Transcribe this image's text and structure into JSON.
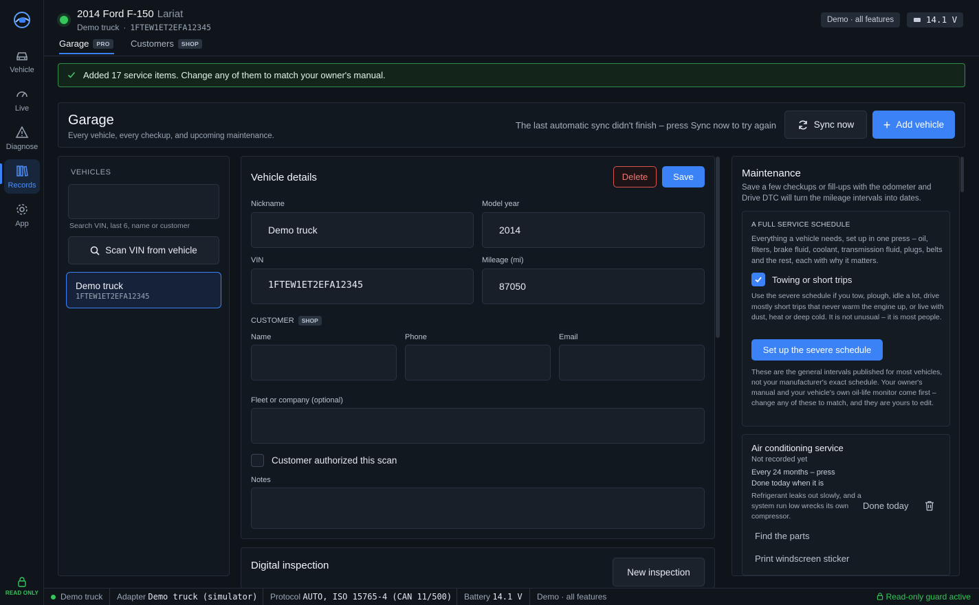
{
  "rail": {
    "items": [
      {
        "label": "Vehicle",
        "icon": "car-icon"
      },
      {
        "label": "Live",
        "icon": "gauge-icon"
      },
      {
        "label": "Diagnose",
        "icon": "warning-icon"
      },
      {
        "label": "Records",
        "icon": "books-icon",
        "active": true
      },
      {
        "label": "App",
        "icon": "gear-icon"
      }
    ],
    "read_only_label": "READ ONLY"
  },
  "header": {
    "vehicle_title": "2014 Ford F-150",
    "vehicle_trim": "Lariat",
    "nickname": "Demo truck",
    "separator": "·",
    "vin": "1FTEW1ET2EFA12345",
    "demo_label": "Demo · all features",
    "voltage": "14.1 V",
    "tabs": [
      {
        "label": "Garage",
        "badge": "PRO",
        "active": true
      },
      {
        "label": "Customers",
        "badge": "SHOP",
        "active": false
      }
    ]
  },
  "toast": {
    "text": "Added 17 service items. Change any of them to match your owner's manual."
  },
  "garage": {
    "title": "Garage",
    "description": "Every vehicle, every checkup, and upcoming maintenance.",
    "sync_message": "The last automatic sync didn't finish – press Sync now to try again",
    "sync_button": "Sync now",
    "add_button": "Add vehicle"
  },
  "vehicles": {
    "heading": "VEHICLES",
    "search_value": "",
    "search_hint": "Search VIN, last 6, name or customer",
    "scan_button": "Scan VIN from vehicle",
    "list": [
      {
        "name": "Demo truck",
        "vin": "1FTEW1ET2EFA12345"
      }
    ]
  },
  "details": {
    "title": "Vehicle details",
    "delete_button": "Delete",
    "save_button": "Save",
    "nickname_label": "Nickname",
    "nickname_value": "Demo truck",
    "model_year_label": "Model year",
    "model_year_value": "2014",
    "vin_label": "VIN",
    "vin_value": "1FTEW1ET2EFA12345",
    "mileage_label": "Mileage (mi)",
    "mileage_value": "87050",
    "customer_heading": "CUSTOMER",
    "customer_badge": "SHOP",
    "name_label": "Name",
    "phone_label": "Phone",
    "email_label": "Email",
    "fleet_label": "Fleet or company (optional)",
    "authorized_label": "Customer authorized this scan",
    "authorized_checked": false,
    "notes_label": "Notes"
  },
  "inspection": {
    "title": "Digital inspection",
    "new_button": "New inspection"
  },
  "maintenance": {
    "title": "Maintenance",
    "intro": "Save a few checkups or fill-ups with the odometer and Drive DTC will turn the mileage intervals into dates.",
    "schedule": {
      "heading": "A FULL SERVICE SCHEDULE",
      "text": "Everything a vehicle needs, set up in one press – oil, filters, brake fluid, coolant, transmission fluid, plugs, belts and the rest, each with why it matters.",
      "towing_label": "Towing or short trips",
      "towing_checked": true,
      "severe_text": "Use the severe schedule if you tow, plough, idle a lot, drive mostly short trips that never warm the engine up, or live with dust, heat or deep cold. It is not unusual – it is most people.",
      "severe_button": "Set up the severe schedule",
      "disclaimer": "These are the general intervals published for most vehicles, not your manufacturer's exact schedule. Your owner's manual and your vehicle's own oil-life monitor come first – change any of these to match, and they are yours to edit."
    },
    "item": {
      "name": "Air conditioning service",
      "status": "Not recorded yet",
      "interval_line1": "Every 24 months – press",
      "interval_line2": "Done today when it is",
      "why": "Refrigerant leaks out slowly, and a system run low wrecks its own compressor.",
      "done_button": "Done today",
      "parts_link": "Find the parts",
      "sticker_link": "Print windscreen sticker"
    }
  },
  "status_bar": {
    "vehicle": "Demo truck",
    "adapter_label": "Adapter",
    "adapter_value": "Demo truck (simulator)",
    "protocol_label": "Protocol",
    "protocol_value": "AUTO, ISO 15765-4 (CAN 11/500)",
    "battery_label": "Battery",
    "battery_value": "14.1 V",
    "demo": "Demo · all features",
    "guard": "Read-only guard active"
  },
  "colors": {
    "accent": "#3b82f6",
    "success": "#34c759",
    "danger": "#d9534f",
    "background": "#0f141b"
  }
}
